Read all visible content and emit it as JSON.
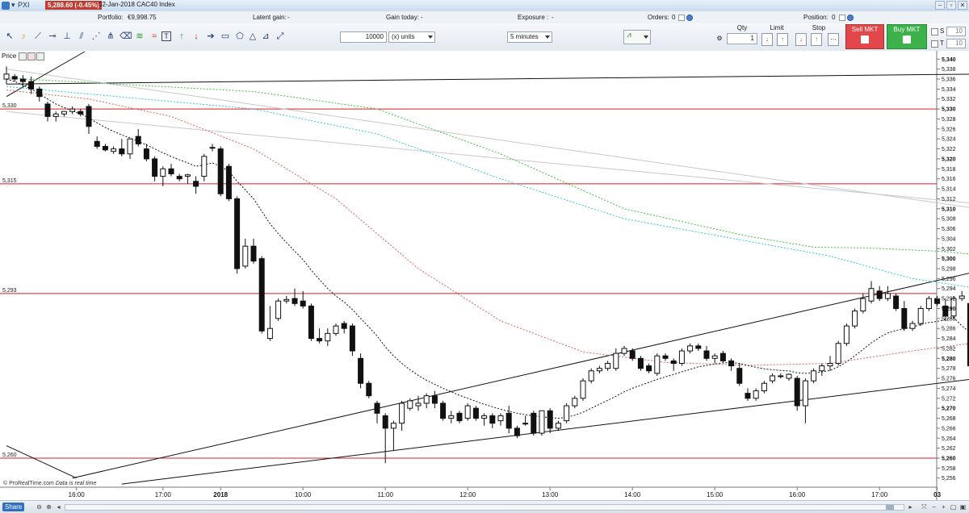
{
  "window": {
    "menu_glyph": "▾",
    "symbol": "PXI",
    "price_badge": "5,288.60 (-0.45%)",
    "instrument": "02-Jan-2018 CAC40 Index",
    "minimize": "–",
    "restore": "▫",
    "close": "✕"
  },
  "status": {
    "portfolio_label": "Portfolio:",
    "portfolio_value": "€9,998.75",
    "latent_label": "Latent gain:",
    "latent_value": "-",
    "today_label": "Gain today:",
    "today_value": "-",
    "exposure_label": "Exposure :",
    "exposure_value": "-",
    "orders_label": "Orders:",
    "orders_value": "0",
    "position_label": "Position:",
    "position_value": "0"
  },
  "toolbar": {
    "quantity_value": "10000",
    "quantity_unit": "(x) units",
    "timeframe": "5 minutes",
    "qty_label": "Qty",
    "qty_value": "1",
    "limit_label": "Limit",
    "stop_label": "Stop",
    "sell_label": "Sell MKT",
    "buy_label": "Buy MKT",
    "s_label": "S",
    "s_value": "10",
    "t_label": "T",
    "t_value": "10"
  },
  "chart_panel": {
    "price_label": "Price",
    "watermark_brand": "© ProRealTime.com",
    "watermark_note": "Data is real time"
  },
  "bottom": {
    "share_label": "Share"
  },
  "chart_data": {
    "type": "candlestick",
    "timeframe": "5 minutes",
    "instrument": "CAC40 Index",
    "ylim": [
      5254.5,
      5341.5
    ],
    "y_ticks": [
      5256,
      5258,
      5260,
      5262,
      5264,
      5266,
      5268,
      5270,
      5272,
      5274,
      5276,
      5278,
      5280,
      5282,
      5284,
      5286,
      5288,
      5290,
      5292,
      5294,
      5296,
      5298,
      5300,
      5302,
      5304,
      5306,
      5308,
      5310,
      5312,
      5314,
      5316,
      5318,
      5320,
      5322,
      5324,
      5326,
      5328,
      5330,
      5332,
      5334,
      5336,
      5338,
      5340
    ],
    "y_ticks_bold": [
      5260,
      5270,
      5280,
      5290,
      5300,
      5310,
      5320,
      5330,
      5340
    ],
    "x_labels": [
      {
        "label": "16:00",
        "bar": 8.5
      },
      {
        "label": "17:00",
        "bar": 19
      },
      {
        "label": "2018",
        "bar": 26
      },
      {
        "label": "10:00",
        "bar": 36
      },
      {
        "label": "11:00",
        "bar": 46
      },
      {
        "label": "12:00",
        "bar": 56
      },
      {
        "label": "13:00",
        "bar": 66
      },
      {
        "label": "14:00",
        "bar": 76
      },
      {
        "label": "15:00",
        "bar": 86
      },
      {
        "label": "16:00",
        "bar": 96
      },
      {
        "label": "17:00",
        "bar": 106
      },
      {
        "label": "03",
        "bar": 113
      }
    ],
    "last_price": 5288.6,
    "change_pct": -0.45,
    "price_levels": [
      {
        "value": 5330,
        "label": "5,330"
      },
      {
        "value": 5315,
        "label": "5,315"
      },
      {
        "value": 5293,
        "label": "5,293"
      },
      {
        "value": 5260,
        "label": "5,260"
      }
    ],
    "ohlc": [
      [
        5336,
        5338.5,
        5335,
        5337
      ],
      [
        5336.5,
        5337,
        5335.5,
        5336
      ],
      [
        5336,
        5336.8,
        5334.5,
        5335.5
      ],
      [
        5335.5,
        5336.5,
        5333,
        5334
      ],
      [
        5334,
        5334.5,
        5331.5,
        5332.5
      ],
      [
        5331,
        5331.5,
        5327.5,
        5328.5
      ],
      [
        5328.5,
        5329.5,
        5327.5,
        5329
      ],
      [
        5329,
        5329.5,
        5328.5,
        5329.5
      ],
      [
        5329.5,
        5330.5,
        5329,
        5330
      ],
      [
        5329.5,
        5330,
        5328.5,
        5329
      ],
      [
        5330.5,
        5331,
        5325,
        5326.5
      ],
      [
        5323.5,
        5324.5,
        5322,
        5322.5
      ],
      [
        5322.5,
        5323,
        5321.5,
        5321.8
      ],
      [
        5321.5,
        5322.5,
        5321,
        5322
      ],
      [
        5322,
        5324,
        5320.5,
        5321
      ],
      [
        5321,
        5324,
        5320,
        5324
      ],
      [
        5324.5,
        5326,
        5322.5,
        5323
      ],
      [
        5322,
        5323,
        5319.5,
        5320
      ],
      [
        5320,
        5320.5,
        5315.5,
        5316.5
      ],
      [
        5316.5,
        5318.5,
        5314.5,
        5318
      ],
      [
        5318,
        5319,
        5316.5,
        5317
      ],
      [
        5316.5,
        5317,
        5315.5,
        5316
      ],
      [
        5316.5,
        5317,
        5315,
        5316.8
      ],
      [
        5315.5,
        5316.5,
        5313,
        5314.5
      ],
      [
        5316.5,
        5321,
        5315.5,
        5320.5
      ],
      [
        5322.3,
        5323,
        5321.5,
        5322.3
      ],
      [
        5322,
        5322.5,
        5312.5,
        5313
      ],
      [
        5318.5,
        5319,
        5311.5,
        5312
      ],
      [
        5312,
        5312.5,
        5297,
        5298
      ],
      [
        5298.5,
        5304,
        5298,
        5302.5
      ],
      [
        5302.5,
        5304,
        5299,
        5299.5
      ],
      [
        5300,
        5300.5,
        5285,
        5285.5
      ],
      [
        5284,
        5290.5,
        5283.5,
        5286
      ],
      [
        5288,
        5292,
        5287.5,
        5291.5
      ],
      [
        5291.5,
        5292.5,
        5291,
        5291.8
      ],
      [
        5292,
        5294,
        5290.5,
        5291
      ],
      [
        5291.5,
        5293.5,
        5290,
        5290.5
      ],
      [
        5290.5,
        5291,
        5283.5,
        5284
      ],
      [
        5284,
        5286,
        5283,
        5283.5
      ],
      [
        5283.5,
        5286,
        5282.5,
        5285
      ],
      [
        5285,
        5287,
        5284.5,
        5286.5
      ],
      [
        5287,
        5287.5,
        5285,
        5286
      ],
      [
        5286.5,
        5287,
        5280.5,
        5281.5
      ],
      [
        5280,
        5281,
        5274,
        5275
      ],
      [
        5275,
        5275.5,
        5272,
        5272.5
      ],
      [
        5271,
        5271.5,
        5267,
        5269
      ],
      [
        5268.5,
        5269,
        5259,
        5266
      ],
      [
        5266,
        5267.5,
        5261.5,
        5267
      ],
      [
        5267,
        5271.5,
        5265.5,
        5271
      ],
      [
        5270,
        5272,
        5269.5,
        5271.5
      ],
      [
        5270.5,
        5272.5,
        5269.5,
        5271
      ],
      [
        5271,
        5273,
        5270,
        5272.5
      ],
      [
        5272.5,
        5273.5,
        5270,
        5271
      ],
      [
        5271,
        5271.5,
        5267.5,
        5268
      ],
      [
        5268,
        5269.5,
        5267,
        5268.5
      ],
      [
        5269,
        5269.5,
        5267,
        5267.5
      ],
      [
        5268,
        5271,
        5267.5,
        5270.5
      ],
      [
        5270,
        5270.5,
        5267.5,
        5268
      ],
      [
        5268,
        5269,
        5266.5,
        5268.5
      ],
      [
        5268.5,
        5269,
        5266,
        5267
      ],
      [
        5267.5,
        5269,
        5266.5,
        5268.5
      ],
      [
        5269,
        5270.5,
        5265,
        5266
      ],
      [
        5266,
        5266.5,
        5264,
        5264.5
      ],
      [
        5267,
        5268.5,
        5266.5,
        5267
      ],
      [
        5269,
        5269.5,
        5264.5,
        5265
      ],
      [
        5265,
        5269.5,
        5264.5,
        5269.5
      ],
      [
        5269.5,
        5270,
        5265,
        5266
      ],
      [
        5266,
        5267.5,
        5265.5,
        5267
      ],
      [
        5267.5,
        5271,
        5267,
        5270.5
      ],
      [
        5270.5,
        5272.5,
        5270,
        5272
      ],
      [
        5272,
        5276,
        5271.5,
        5275.5
      ],
      [
        5275.5,
        5278,
        5275,
        5277.5
      ],
      [
        5277.5,
        5278.5,
        5277,
        5278
      ],
      [
        5278,
        5279.5,
        5277.5,
        5279
      ],
      [
        5278,
        5282,
        5277.5,
        5281
      ],
      [
        5281,
        5282.5,
        5280.5,
        5282
      ],
      [
        5281.5,
        5282,
        5279.5,
        5280
      ],
      [
        5280,
        5280.5,
        5277.5,
        5278
      ],
      [
        5278.5,
        5279,
        5277,
        5277.5
      ],
      [
        5277,
        5281,
        5276.5,
        5280.5
      ],
      [
        5280.5,
        5281,
        5279.5,
        5280
      ],
      [
        5279.5,
        5280,
        5277.5,
        5279
      ],
      [
        5279,
        5282,
        5278.5,
        5281.5
      ],
      [
        5281.5,
        5283,
        5281,
        5282.5
      ],
      [
        5282.5,
        5283,
        5281.5,
        5282
      ],
      [
        5281.5,
        5282.5,
        5279.5,
        5280
      ],
      [
        5280,
        5281,
        5279,
        5280.5
      ],
      [
        5281,
        5281.5,
        5279,
        5279.5
      ],
      [
        5279.5,
        5280,
        5277.5,
        5278.5
      ],
      [
        5278,
        5279,
        5274.5,
        5275
      ],
      [
        5273,
        5274,
        5271.5,
        5272
      ],
      [
        5272,
        5274,
        5271.5,
        5273.5
      ],
      [
        5273.5,
        5275.5,
        5273,
        5275
      ],
      [
        5275.5,
        5277,
        5275,
        5276.5
      ],
      [
        5276.5,
        5277,
        5276,
        5276.5
      ],
      [
        5276,
        5277,
        5275.5,
        5276.8
      ],
      [
        5276,
        5276.5,
        5269.5,
        5270.5
      ],
      [
        5270.5,
        5276,
        5267,
        5275.5
      ],
      [
        5275.5,
        5278,
        5275,
        5277.5
      ],
      [
        5277.5,
        5279,
        5276.5,
        5278.5
      ],
      [
        5278.5,
        5280.5,
        5277.5,
        5279
      ],
      [
        5279,
        5283.5,
        5278.5,
        5283
      ],
      [
        5283,
        5287,
        5282.5,
        5286.5
      ],
      [
        5286.5,
        5290,
        5286,
        5289.5
      ],
      [
        5289.5,
        5293,
        5289,
        5292
      ],
      [
        5291.5,
        5295.5,
        5291,
        5294
      ],
      [
        5293.5,
        5294.5,
        5291.5,
        5292
      ],
      [
        5292,
        5294.5,
        5291.5,
        5293
      ],
      [
        5292.5,
        5293,
        5289.5,
        5290
      ],
      [
        5290,
        5291.5,
        5285.5,
        5286
      ],
      [
        5286,
        5287.5,
        5285.5,
        5287
      ],
      [
        5287,
        5290.5,
        5286.5,
        5290
      ],
      [
        5290,
        5292.5,
        5289.5,
        5292
      ],
      [
        5292,
        5292.5,
        5290.5,
        5291
      ],
      [
        5290.5,
        5292,
        5287.5,
        5288.5
      ],
      [
        5288.5,
        5292.5,
        5288,
        5292
      ],
      [
        5292,
        5293.5,
        5291.5,
        5292.5
      ],
      [
        5291,
        5291.5,
        5278,
        5278.5
      ],
      [
        5278.5,
        5281,
        5276,
        5280.5
      ],
      [
        5280,
        5288.6,
        5279.5,
        5288.6
      ]
    ],
    "ma_20": [
      5336,
      5335.5,
      5334.8,
      5334,
      5333,
      5332,
      5331,
      5330.3,
      5329.6,
      5329,
      5328.2,
      5327.2,
      5326.3,
      5325.5,
      5324.8,
      5324.2,
      5323.5,
      5322.8,
      5322,
      5321.2,
      5320.5,
      5319.8,
      5319.2,
      5318.5,
      5318.8,
      5319.2,
      5318.5,
      5317.5,
      5315.5,
      5313.8,
      5312,
      5309.5,
      5307,
      5305,
      5303.2,
      5301.5,
      5299.8,
      5297.7,
      5295.8,
      5294,
      5292.5,
      5291.3,
      5289.8,
      5288,
      5286.3,
      5284.5,
      5282.3,
      5280.5,
      5279,
      5277.7,
      5276.6,
      5275.6,
      5274.8,
      5274,
      5273.3,
      5272.6,
      5272,
      5271.4,
      5270.8,
      5270.3,
      5269.8,
      5269.4,
      5269,
      5268.7,
      5268.5,
      5268.3,
      5268.1,
      5268,
      5268.2,
      5268.6,
      5269.2,
      5270,
      5270.8,
      5271.6,
      5272.4,
      5273.3,
      5274,
      5274.6,
      5275.2,
      5275.8,
      5276.3,
      5276.8,
      5277.3,
      5277.8,
      5278.3,
      5278.6,
      5278.9,
      5279.1,
      5279.2,
      5279,
      5278.6,
      5278.2,
      5277.9,
      5277.7,
      5277.6,
      5277.5,
      5277.1,
      5277,
      5277.1,
      5277.3,
      5277.6,
      5278.3,
      5279.3,
      5280.5,
      5281.8,
      5283.1,
      5284.2,
      5285.1,
      5285.6,
      5285.9,
      5286.3,
      5286.8,
      5287.2,
      5287.4,
      5287.8,
      5288.2,
      5286.5,
      5285.2,
      5285.8
    ],
    "ma_50": [
      [
        0,
        5333.8
      ],
      [
        10,
        5332
      ],
      [
        20,
        5328.5
      ],
      [
        30,
        5322
      ],
      [
        40,
        5312
      ],
      [
        50,
        5298
      ],
      [
        60,
        5287.5
      ],
      [
        70,
        5281.3
      ],
      [
        80,
        5279.2
      ],
      [
        90,
        5278.6
      ],
      [
        100,
        5279
      ],
      [
        110,
        5281.5
      ],
      [
        117,
        5283
      ],
      [
        118,
        5282.5
      ]
    ],
    "ma_100": [
      [
        0,
        5334.5
      ],
      [
        30,
        5330
      ],
      [
        45,
        5325
      ],
      [
        60,
        5316
      ],
      [
        75,
        5308
      ],
      [
        90,
        5303.5
      ],
      [
        100,
        5300.5
      ],
      [
        110,
        5296
      ],
      [
        118,
        5294
      ]
    ],
    "ma_200": [
      [
        0,
        5336.2
      ],
      [
        30,
        5333.5
      ],
      [
        45,
        5330
      ],
      [
        60,
        5321
      ],
      [
        75,
        5310
      ],
      [
        90,
        5304.5
      ],
      [
        98,
        5302.3
      ],
      [
        105,
        5302.1
      ],
      [
        113,
        5301.5
      ],
      [
        118,
        5300.8
      ]
    ],
    "trend_lines": [
      {
        "from": [
          0,
          5335
        ],
        "to": [
          118,
          5337
        ],
        "color": "dark"
      },
      {
        "from": [
          0,
          5338
        ],
        "to": [
          118,
          5310
        ],
        "color": "light"
      },
      {
        "from": [
          0,
          5329.5
        ],
        "to": [
          118,
          5311
        ],
        "color": "light"
      },
      {
        "from": [
          8,
          5256
        ],
        "to": [
          118,
          5297.5
        ],
        "color": "dark"
      },
      {
        "from": [
          14,
          5254.8
        ],
        "to": [
          118,
          5276
        ],
        "color": "dark"
      },
      {
        "from": [
          0,
          5262.5
        ],
        "to": [
          8.5,
          5256
        ],
        "color": "dark"
      },
      {
        "from": [
          0,
          5332.5
        ],
        "to": [
          9.5,
          5341.5
        ],
        "color": "dark"
      }
    ],
    "colors": {
      "bull_candle": "#ffffff",
      "bear_candle": "#111111",
      "ma_20": "#111111",
      "ma_50": "#e06060",
      "ma_100": "#30c8d8",
      "ma_200": "#40c040",
      "price_level": "#d42020",
      "trend_dark": "#111111",
      "trend_light": "#c8c8c8"
    }
  }
}
